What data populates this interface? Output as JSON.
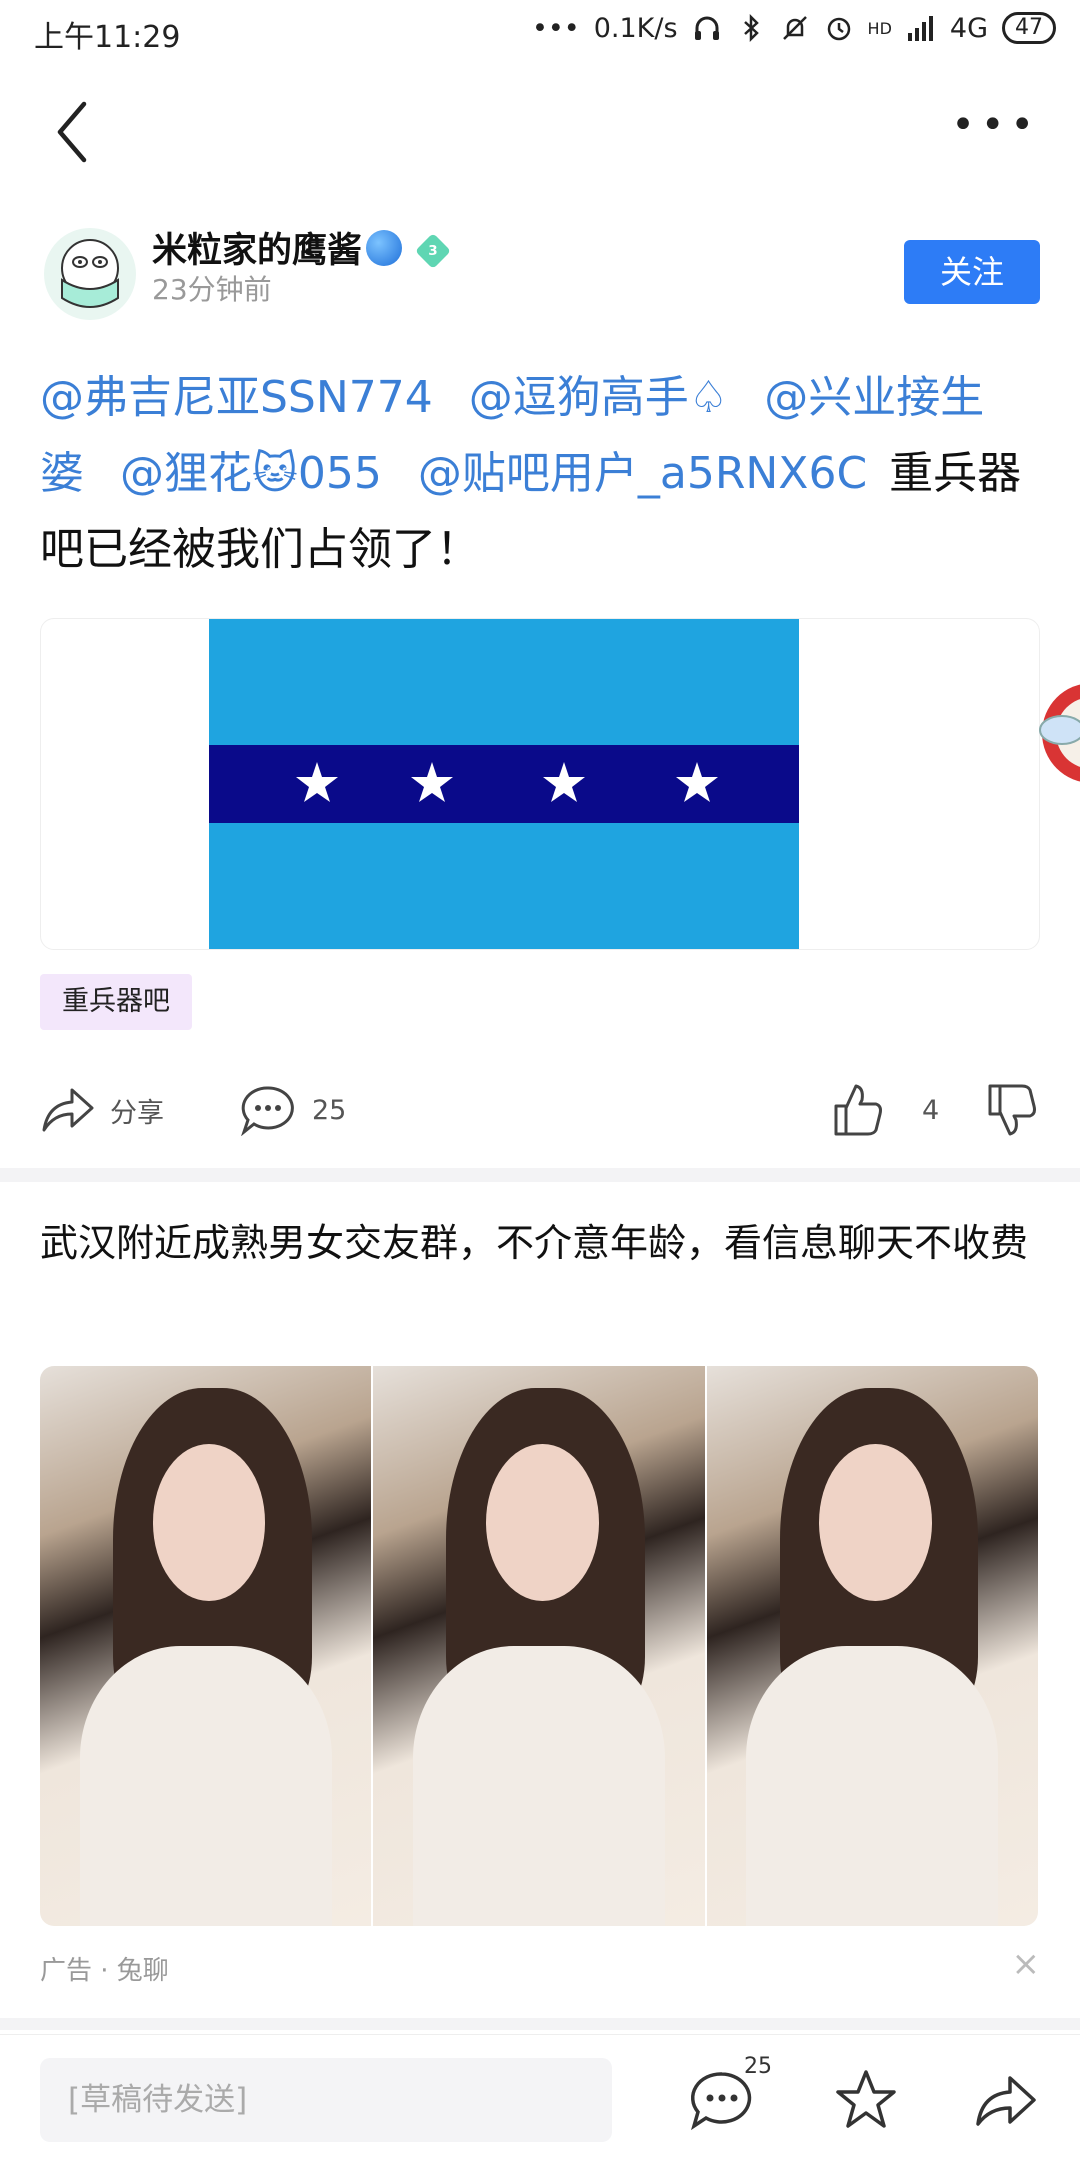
{
  "status_bar": {
    "time": "上午11:29",
    "net_speed": "0.1K/s",
    "signal_hd": "HD",
    "network": "4G",
    "battery": "47"
  },
  "author": {
    "name": "米粒家的鹰酱",
    "level": "3",
    "time": "23分钟前",
    "follow_label": "关注"
  },
  "post": {
    "mentions": [
      "@弗吉尼亚SSN774",
      "@逗狗高手♤",
      "@兴业接生婆",
      "@狸花🐱055",
      "@贴吧用户_a5RNX6C"
    ],
    "body": "重兵器吧已经被我们占领了！",
    "tag": "重兵器吧"
  },
  "actions": {
    "share_label": "分享",
    "comment_count": "25",
    "like_count": "4"
  },
  "ad": {
    "title": "武汉附近成熟男女交友群，不介意年龄，看信息聊天不收费",
    "footer": "广告 · 兔聊",
    "close": "×"
  },
  "bottom_bar": {
    "draft_placeholder": "[草稿待发送]",
    "comment_badge": "25"
  },
  "colors": {
    "accent": "#2d7cf6",
    "mention": "#3b7fd6",
    "flag_light": "#1fa4e0",
    "flag_dark": "#0a0a8a"
  },
  "icons": [
    "back-arrow-icon",
    "more-icon",
    "globe-icon",
    "level-badge-icon",
    "share-icon",
    "comment-icon",
    "like-icon",
    "dislike-icon",
    "star-icon",
    "forward-icon"
  ]
}
